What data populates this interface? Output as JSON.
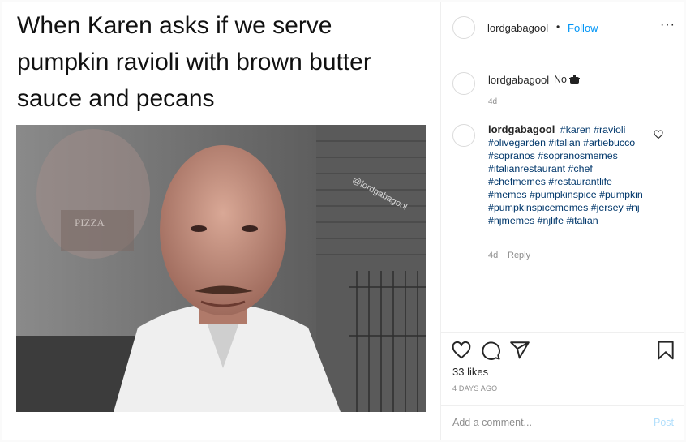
{
  "meme": {
    "caption": "When Karen asks if we serve pumpkin ravioli with brown butter sauce and pecans",
    "watermark": "@lordgabagool",
    "sign_text": "PIZZA"
  },
  "header": {
    "username": "lordgabagool",
    "separator": "•",
    "follow_label": "Follow",
    "more_label": "···"
  },
  "comments": [
    {
      "username": "lordgabagool",
      "text": "No",
      "emoji_icon": "cooking-pot-icon",
      "time": "4d"
    },
    {
      "username": "lordgabagool",
      "hashtags": [
        "#karen",
        "#ravioli",
        "#olivegarden",
        "#italian",
        "#artiebucco",
        "#sopranos",
        "#sopranosmemes",
        "#italianrestaurant",
        "#chef",
        "#chefmemes",
        "#restaurantlife",
        "#memes",
        "#pumpkinspice",
        "#pumpkin",
        "#pumpkinspicememes",
        "#jersey",
        "#nj",
        "#njmemes",
        "#njlife",
        "#italian"
      ],
      "time": "4d",
      "reply_label": "Reply"
    }
  ],
  "actions": {
    "icons": [
      "heart-icon",
      "comment-icon",
      "share-icon",
      "bookmark-icon"
    ],
    "likes": "33 likes",
    "posted_ago": "4 DAYS AGO"
  },
  "add_comment": {
    "placeholder": "Add a comment...",
    "post_label": "Post"
  },
  "colors": {
    "link_blue": "#0095f6",
    "hashtag": "#00376b",
    "muted": "#8e8e8e",
    "border": "#dbdbdb"
  }
}
